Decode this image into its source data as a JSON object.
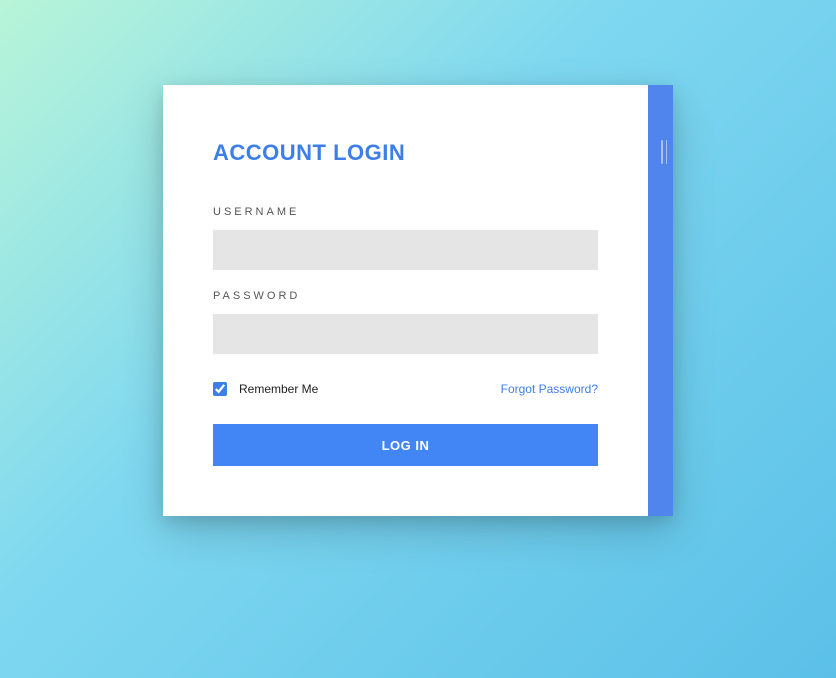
{
  "login": {
    "title": "ACCOUNT LOGIN",
    "username_label": "USERNAME",
    "username_value": "",
    "password_label": "PASSWORD",
    "password_value": "",
    "remember_label": "Remember Me",
    "remember_checked": true,
    "forgot_label": "Forgot Password?",
    "submit_label": "LOG IN"
  },
  "colors": {
    "accent": "#3d7ee8",
    "button": "#4285f4",
    "side_panel": "#4f85ed"
  }
}
